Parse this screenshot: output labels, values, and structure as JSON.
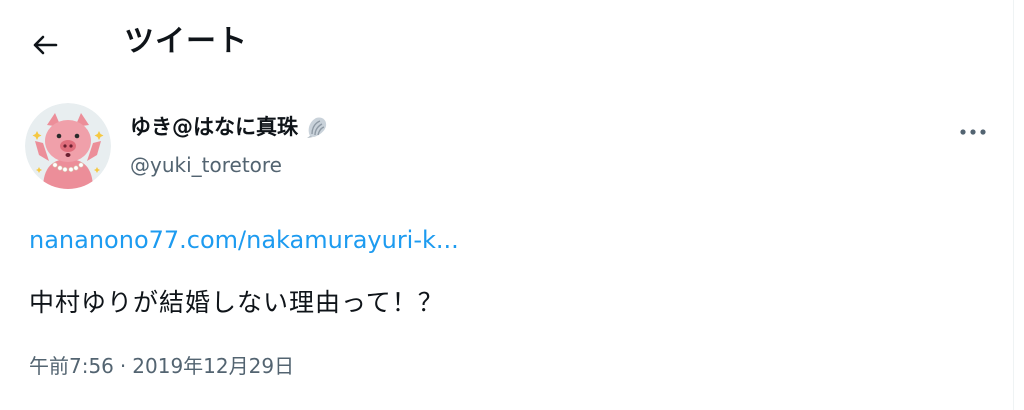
{
  "header": {
    "title": "ツイート",
    "back_icon": "arrow-left-icon"
  },
  "tweet": {
    "author": {
      "display_name": "ゆき@はなに真珠",
      "badge_icon": "shell-icon",
      "handle": "@yuki_toretore",
      "avatar_icon": "pig-avatar-icon"
    },
    "more_icon": "more-horizontal-icon",
    "link_text": "nananono77.com/nakamurayuri-k...",
    "text": "中村ゆりが結婚しない理由って！？",
    "time": "午前7:56",
    "separator": "·",
    "date": "2019年12月29日"
  },
  "colors": {
    "link": "#1d9bf0",
    "text": "#0f1419",
    "secondary": "#536471",
    "avatar_bg": "#e8eef0",
    "pig_pink": "#ec8e99"
  }
}
